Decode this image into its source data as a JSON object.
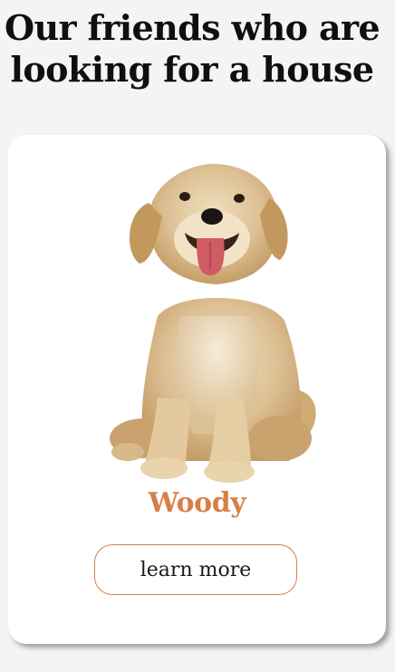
{
  "header": {
    "title": "Our friends who are looking for a house"
  },
  "pets": [
    {
      "name": "Woody",
      "photo_icon": "puppy-photo",
      "button_label": "learn more"
    }
  ],
  "colors": {
    "background": "#f4f4f4",
    "card": "#ffffff",
    "accent": "#d87f48",
    "text": "#0f0f0f"
  }
}
